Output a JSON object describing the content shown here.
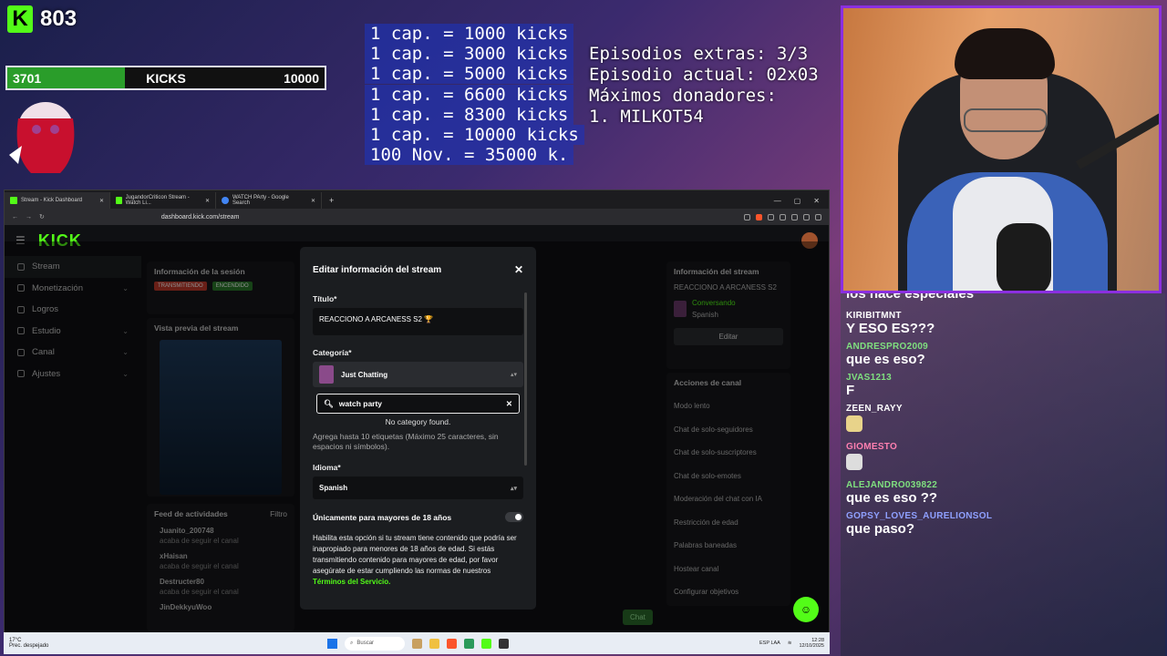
{
  "overlay": {
    "kick_count": "803",
    "goal_current": "3701",
    "goal_label": "KICKS",
    "goal_max": "10000",
    "goal_progress": 0.3701,
    "cap_list": [
      "1 cap. = 1000 kicks",
      "1 cap. = 3000 kicks",
      "1 cap. = 5000 kicks",
      "1 cap. = 6600 kicks",
      "1 cap. = 8300 kicks",
      "1 cap. = 10000 kicks",
      "100 Nov. = 35000 k."
    ],
    "episode_info": [
      "Episodios extras: 3/3",
      "Episodio actual: 02x03",
      "Máximos donadores:",
      "1. MILKOT54"
    ]
  },
  "chat": {
    "first_line": "los hace especiales",
    "messages": [
      {
        "user": "KIRIBITMNT",
        "color": "#ffffff",
        "text": "Y ESO ES???"
      },
      {
        "user": "ANDRESPRO2009",
        "color": "#7fe07f",
        "text": "que es eso?"
      },
      {
        "user": "JVAS1213",
        "color": "#7fe07f",
        "text": "F"
      },
      {
        "user": "ZEEN_RAYY",
        "color": "#ffffff",
        "text": ""
      },
      {
        "user": "GIOMESTO",
        "color": "#ff7fb0",
        "text": ""
      },
      {
        "user": "ALEJANDRO039822",
        "color": "#7fe07f",
        "text": "que es eso ??"
      },
      {
        "user": "GOPSY_LOVES_AURELIONSOL",
        "color": "#8fa0ff",
        "text": "que paso?"
      }
    ]
  },
  "browser": {
    "tabs": [
      {
        "label": "Stream - Kick Dashboard",
        "active": true
      },
      {
        "label": "JugandorCriticon Stream - Watch Li...",
        "active": false
      },
      {
        "label": "WATCH PArty - Google Search",
        "active": false
      }
    ],
    "url": "dashboard.kick.com/stream",
    "sidebar": [
      {
        "label": "Stream",
        "active": true,
        "chevron": false
      },
      {
        "label": "Monetización",
        "active": false,
        "chevron": true
      },
      {
        "label": "Logros",
        "active": false,
        "chevron": false
      },
      {
        "label": "Estudio",
        "active": false,
        "chevron": true
      },
      {
        "label": "Canal",
        "active": false,
        "chevron": true
      },
      {
        "label": "Ajustes",
        "active": false,
        "chevron": true
      }
    ],
    "session_panel_title": "Información de la sesión",
    "preview_title": "Vista previa del stream",
    "activity_title": "Feed de actividades",
    "activity_filter": "Filtro",
    "activity_items": [
      {
        "name": "Juanito_200748",
        "sub": "acaba de seguir el canal"
      },
      {
        "name": "xHaisan",
        "sub": "acaba de seguir el canal"
      },
      {
        "name": "Destructer80",
        "sub": "acaba de seguir el canal"
      },
      {
        "name": "JinDekkyuWoo",
        "sub": ""
      }
    ],
    "info_panel_title": "Información del stream",
    "info_stream_title": "REACCIONO A ARCANESS S2",
    "info_category": "Conversando",
    "info_language": "Spanish",
    "edit_button": "Editar",
    "actions_title": "Acciones de canal",
    "actions": [
      "Modo lento",
      "Chat de solo-seguidores",
      "Chat de solo-suscriptores",
      "Chat de solo-emotes",
      "Moderación del chat con IA",
      "Restricción de edad",
      "Palabras baneadas",
      "Hostear canal",
      "Configurar objetivos"
    ],
    "chat_button": "Chat"
  },
  "modal": {
    "title": "Editar información del stream",
    "title_label": "Título*",
    "title_value": "REACCIONO A ARCANESS S2",
    "category_label": "Categoría*",
    "category_value": "Just Chatting",
    "search_value": "watch party",
    "no_category": "No category found.",
    "tags_help": "Agrega hasta 10 etiquetas (Máximo 25 caracteres, sin espacios ni símbolos).",
    "language_label": "Idioma*",
    "language_value": "Spanish",
    "adult_label": "Únicamente para mayores de 18 años",
    "adult_desc": "Habilita esta opción si tu stream tiene contenido que podría ser inapropiado para menores de 18 años de edad. Si estás transmitiendo contenido para mayores de edad, por favor asegúrate de estar cumpliendo las normas de nuestros",
    "tos_link": "Términos del Servicio."
  },
  "taskbar": {
    "temp": "17°C",
    "weather": "Prec. despejado",
    "search": "Buscar",
    "lang": "ESP LAA",
    "time": "12:28",
    "date": "12/10/2025"
  }
}
